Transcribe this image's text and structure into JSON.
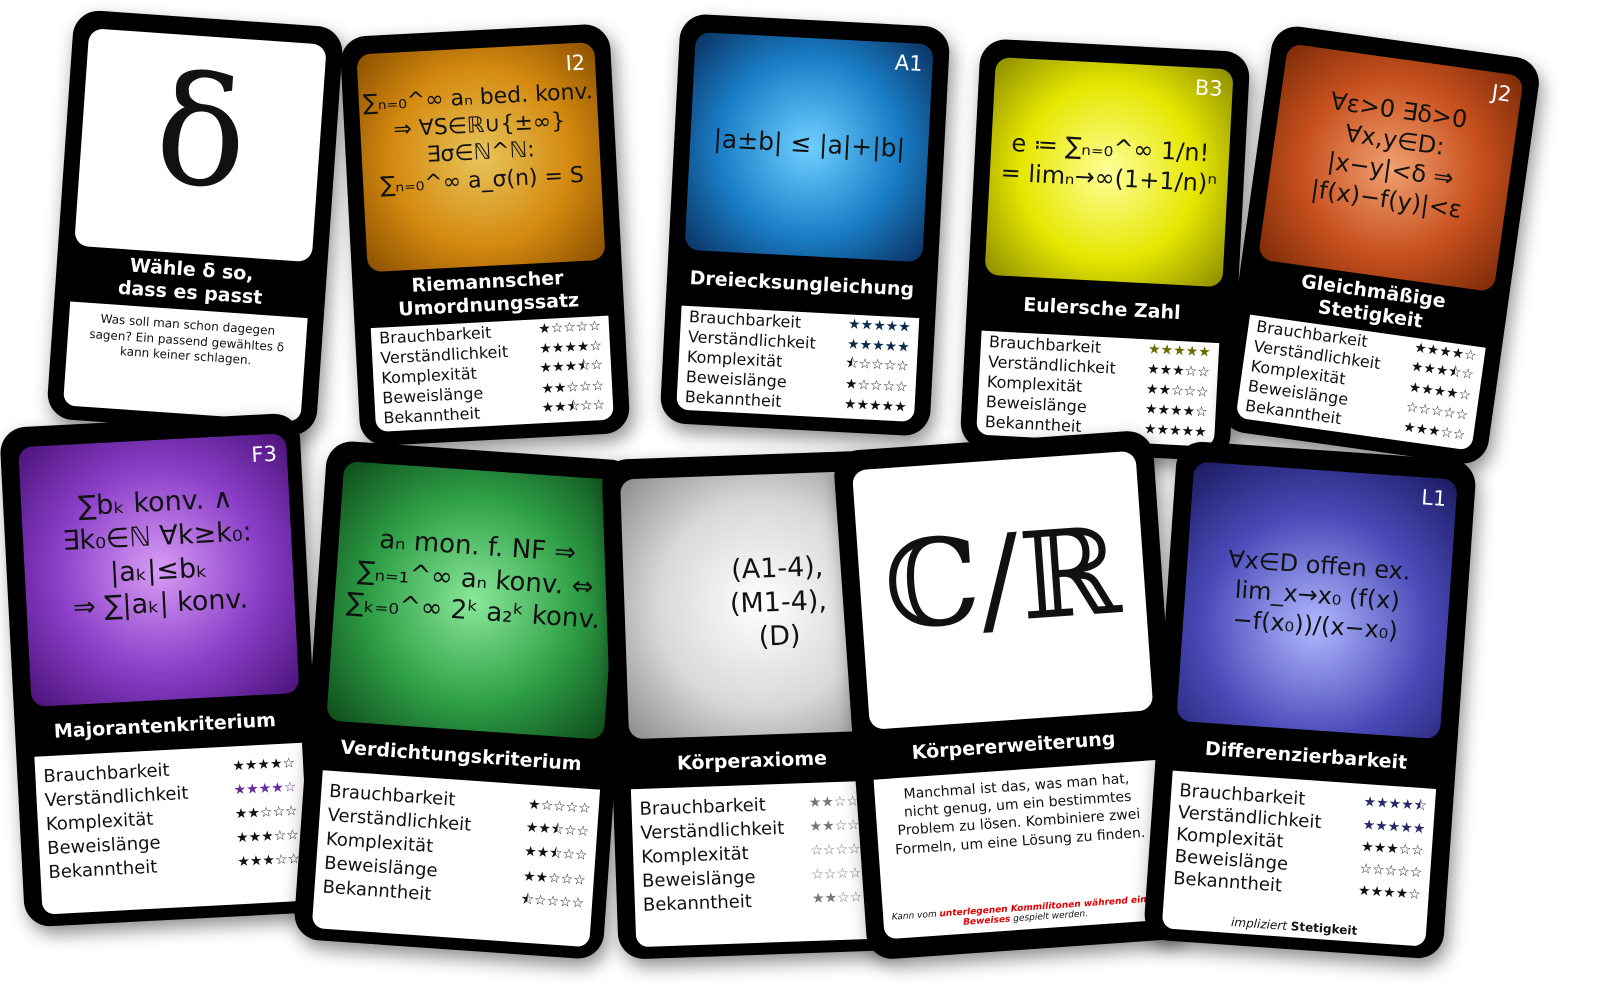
{
  "stat_labels": [
    "Brauchbarkeit",
    "Verständlichkeit",
    "Komplexität",
    "Beweislänge",
    "Bekanntheit"
  ],
  "cards": {
    "delta": {
      "symbol": "δ",
      "title": "Wähle δ so,\ndass es passt",
      "desc": "Was soll man schon dagegen sagen? Ein passend gewähltes δ kann keiner schlagen.",
      "bg": "#ffffff"
    },
    "riemann": {
      "code": "I2",
      "formula": "∑ₙ₌₀^∞ aₙ bed. konv.\n⇒ ∀S∈ℝ∪{±∞}\n∃σ∈ℕ^ℕ:\n∑ₙ₌₀^∞ a_σ(n) = S",
      "title": "Riemannscher\nUmordnungssatz",
      "stars": [
        "★☆☆☆☆",
        "★★★★☆",
        "★★★⯪☆",
        "★★☆☆☆",
        "★★⯪☆☆"
      ],
      "star_color": "#111111",
      "bg": "#d48a10"
    },
    "dreieck": {
      "code": "A1",
      "formula": "|a±b| ≤ |a|+|b|",
      "title": "Dreiecksungleichung",
      "stars": [
        "★★★★★",
        "★★★★★",
        "⯪☆☆☆☆",
        "★☆☆☆☆",
        "★★★★★"
      ],
      "star_color": "#0a2c4e",
      "bg": "#1a7fc8"
    },
    "euler": {
      "code": "B3",
      "formula": "e ≔ ∑ₙ₌₀^∞ 1/n!\n= limₙ→∞(1+1/n)ⁿ",
      "title": "Eulersche Zahl",
      "stars": [
        "★★★★★",
        "★★★☆☆",
        "★★☆☆☆",
        "★★★★☆",
        "★★★★★"
      ],
      "star_color": "#6b6b00",
      "bg": "#e6e600"
    },
    "gleich": {
      "code": "J2",
      "formula": "∀ε>0 ∃δ>0\n∀x,y∈D:\n|x−y|<δ ⇒\n|f(x)−f(y)|<ε",
      "title": "Gleichmäßige\nStetigkeit",
      "stars": [
        "★★★★☆",
        "★★★⯪☆",
        "★★★★☆",
        "☆☆☆☆☆",
        "★★★☆☆"
      ],
      "star_color": "#111111",
      "bg": "#c8501e"
    },
    "majorant": {
      "code": "F3",
      "formula": "∑bₖ konv. ∧\n∃k₀∈ℕ ∀k≥k₀:\n|aₖ|≤bₖ\n⇒ ∑|aₖ| konv.",
      "title": "Majorantenkriterium",
      "stars": [
        "★★★★☆",
        "★★★★☆",
        "★★☆☆☆",
        "★★★☆☆",
        "★★★☆☆"
      ],
      "star_color": "#111111",
      "bg": "#8a3ec8"
    },
    "verdicht": {
      "code": "",
      "formula": "aₙ mon. f. NF ⇒\n∑ₙ₌₁^∞ aₙ konv. ⇔\n∑ₖ₌₀^∞ 2ᵏ a₂ᵏ konv.",
      "title": "Verdichtungskriterium",
      "stars": [
        "★☆☆☆☆",
        "★★⯪☆☆",
        "★★⯪☆☆",
        "★★☆☆☆",
        "⯪☆☆☆☆"
      ],
      "star_color": "#111111",
      "bg": "#2e9e46"
    },
    "koerper": {
      "formula": "(A1-4),\n(M1-4),\n(D)",
      "title": "Körperaxiome",
      "stars": [
        "★★☆☆☆",
        "★★☆☆☆",
        "☆☆☆☆☆",
        "☆☆☆☆☆",
        "★★☆☆☆"
      ],
      "star_color": "#777777",
      "bg": "#cfcfcf"
    },
    "erweiterung": {
      "symbol": "ℂ/ℝ",
      "title": "Körpererweiterung",
      "desc": "Manchmal ist das, was man hat, nicht genug, um ein bestimmtes Problem zu lösen. Kombiniere zwei Formeln, um eine Lösung zu finden.",
      "note_pre": "Kann vom ",
      "note_red": "unterlegenen Kommilitonen während eines Beweises",
      "note_post": " gespielt werden.",
      "bg": "#ffffff"
    },
    "diff": {
      "code": "L1",
      "formula": "∀x∈D offen ex.\nlim_x→x₀ (f(x)−f(x₀))/(x−x₀)",
      "title": "Differenzierbarkeit",
      "stars": [
        "★★★★⯪",
        "★★★★★",
        "★★★☆☆",
        "☆☆☆☆☆",
        "★★★★☆"
      ],
      "star_color": "#2a2a6a",
      "implies_pre": "impliziert ",
      "implies_bold": "Stetigkeit",
      "bg": "#4a4ab8"
    }
  }
}
